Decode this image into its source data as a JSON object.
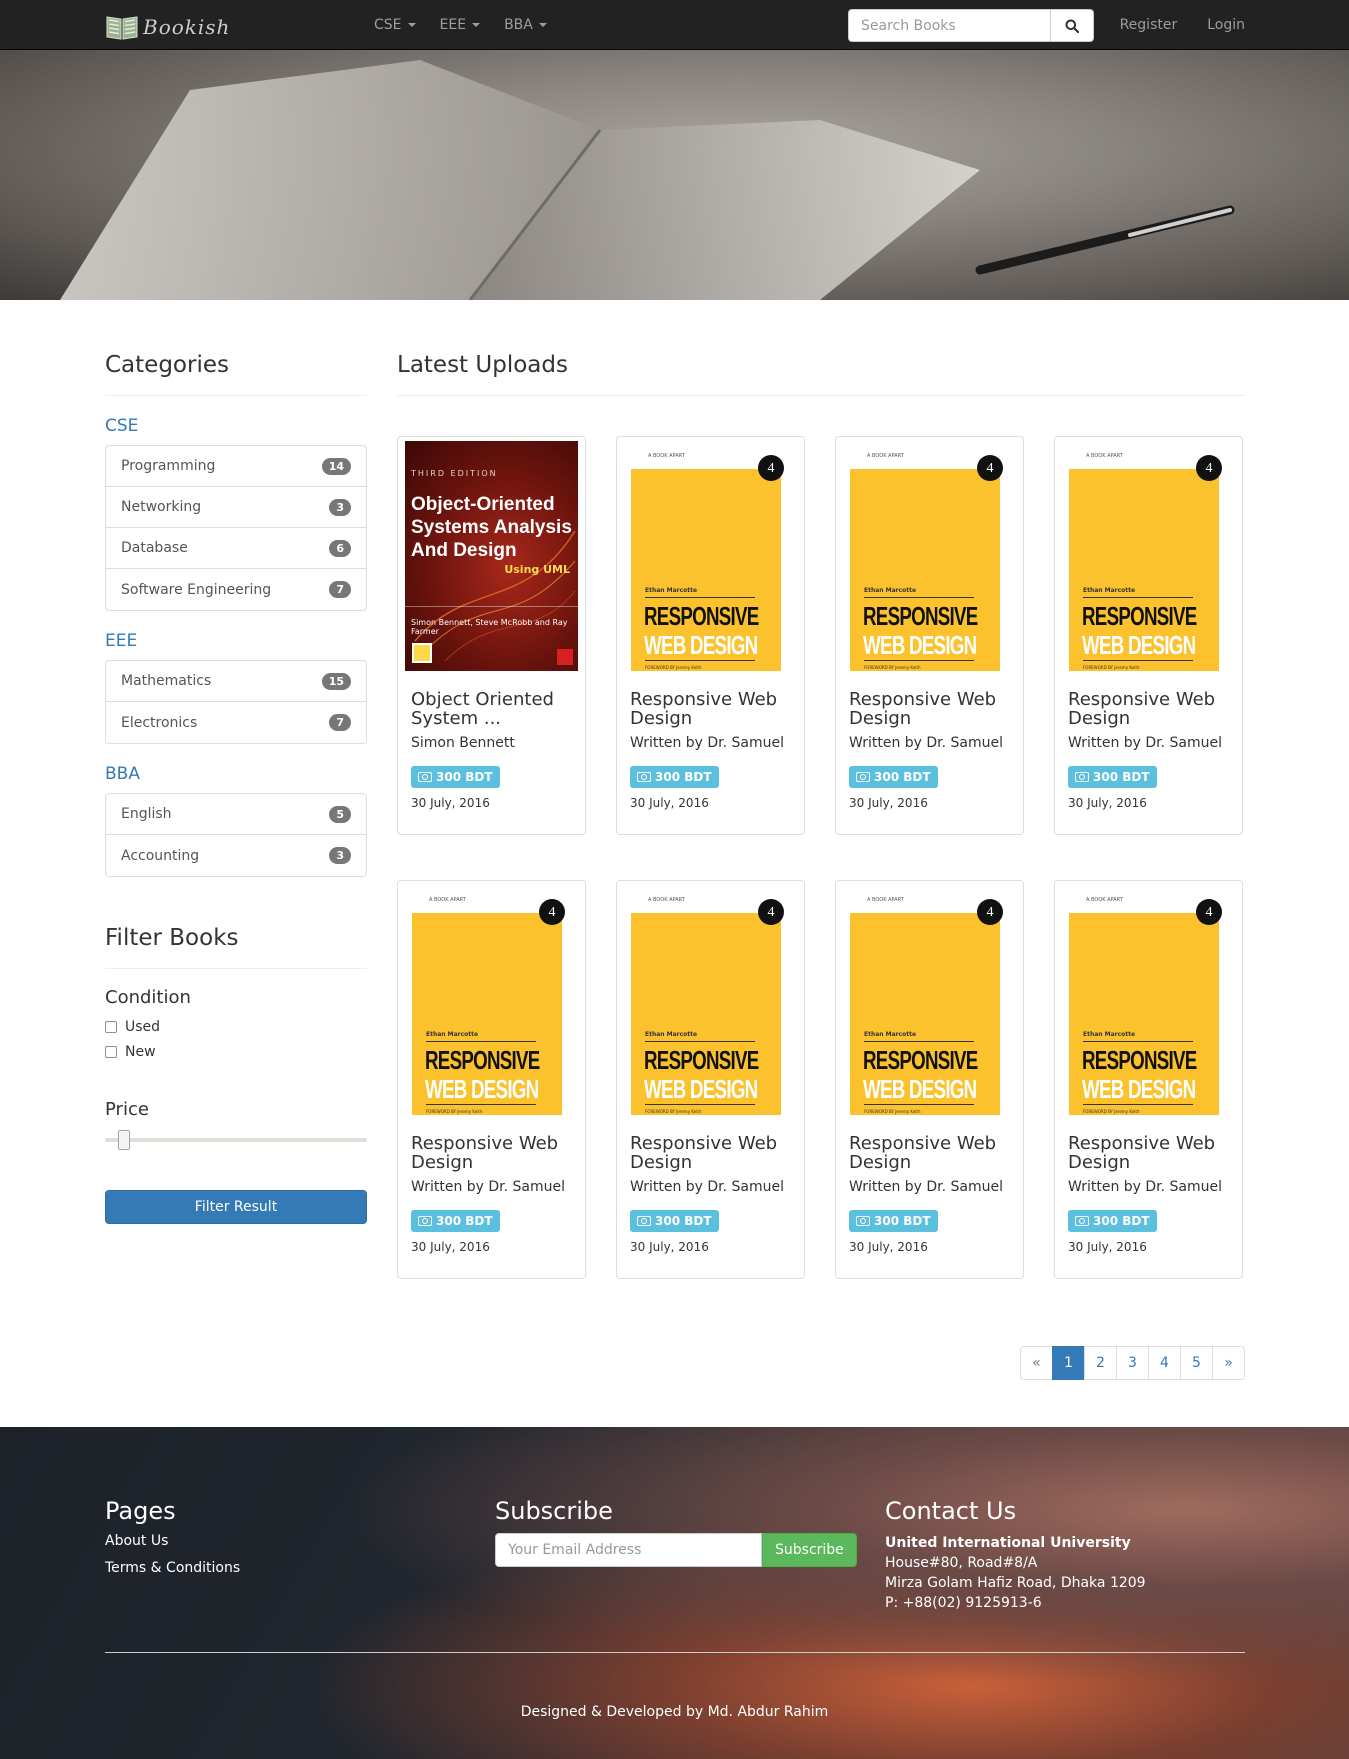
{
  "navbar": {
    "brand": "Bookish",
    "menu": [
      {
        "label": "CSE"
      },
      {
        "label": "EEE"
      },
      {
        "label": "BBA"
      }
    ],
    "search_placeholder": "Search Books",
    "register": "Register",
    "login": "Login"
  },
  "sidebar": {
    "categories_title": "Categories",
    "groups": [
      {
        "title": "CSE",
        "items": [
          {
            "label": "Programming",
            "count": "14"
          },
          {
            "label": "Networking",
            "count": "3"
          },
          {
            "label": "Database",
            "count": "6"
          },
          {
            "label": "Software Engineering",
            "count": "7"
          }
        ]
      },
      {
        "title": "EEE",
        "items": [
          {
            "label": "Mathematics",
            "count": "15"
          },
          {
            "label": "Electronics",
            "count": "7"
          }
        ]
      },
      {
        "title": "BBA",
        "items": [
          {
            "label": "English",
            "count": "5"
          },
          {
            "label": "Accounting",
            "count": "3"
          }
        ]
      }
    ],
    "filter_title": "Filter Books",
    "condition_title": "Condition",
    "conditions": [
      "Used",
      "New"
    ],
    "price_title": "Price",
    "price_slider_value": 0,
    "filter_button": "Filter Result"
  },
  "main": {
    "title": "Latest Uploads",
    "books": [
      {
        "cover": "ooad",
        "title": "Object Oriented System ...",
        "author": "Simon Bennett",
        "price": "300 BDT",
        "date": "30 July, 2016"
      },
      {
        "cover": "rwd",
        "title": "Responsive Web Design",
        "author": "Written by Dr. Samuel",
        "price": "300 BDT",
        "date": "30 July, 2016"
      },
      {
        "cover": "rwd",
        "title": "Responsive Web Design",
        "author": "Written by Dr. Samuel",
        "price": "300 BDT",
        "date": "30 July, 2016"
      },
      {
        "cover": "rwd",
        "title": "Responsive Web Design",
        "author": "Written by Dr. Samuel",
        "price": "300 BDT",
        "date": "30 July, 2016"
      },
      {
        "cover": "rwd",
        "title": "Responsive Web Design",
        "author": "Written by Dr. Samuel",
        "price": "300 BDT",
        "date": "30 July, 2016"
      },
      {
        "cover": "rwd",
        "title": "Responsive Web Design",
        "author": "Written by Dr. Samuel",
        "price": "300 BDT",
        "date": "30 July, 2016"
      },
      {
        "cover": "rwd",
        "title": "Responsive Web Design",
        "author": "Written by Dr. Samuel",
        "price": "300 BDT",
        "date": "30 July, 2016"
      },
      {
        "cover": "rwd",
        "title": "Responsive Web Design",
        "author": "Written by Dr. Samuel",
        "price": "300 BDT",
        "date": "30 July, 2016"
      }
    ],
    "covers": {
      "ooad": {
        "edition": "THIRD EDITION",
        "title_lines": [
          "Object-Oriented",
          "Systems Analysis",
          "And Design"
        ],
        "subtitle": "Using UML",
        "authors": "Simon Bennett, Steve McRobb and Ray Farmer"
      },
      "rwd": {
        "series": "A BOOK APART",
        "number": "4",
        "author": "Ethan Marcotte",
        "title_line1": "RESPONSIVE",
        "title_line2": "WEB DESIGN",
        "foreword": "FOREWORD BY Jeremy Keith"
      }
    }
  },
  "pagination": {
    "prev": "«",
    "pages": [
      "1",
      "2",
      "3",
      "4",
      "5"
    ],
    "active": "1",
    "next": "»"
  },
  "footer": {
    "pages_title": "Pages",
    "links": [
      "About Us",
      "Terms & Conditions"
    ],
    "subscribe_title": "Subscribe",
    "email_placeholder": "Your Email Address",
    "subscribe_button": "Subscribe",
    "contact_title": "Contact Us",
    "contact_name": "United International University",
    "contact_lines": [
      "House#80, Road#8/A",
      "Mirza Golam Hafiz Road, Dhaka 1209",
      "P: +88(02) 9125913-6"
    ],
    "credit": "Designed & Developed by Md. Abdur Rahim"
  },
  "colors": {
    "navbar": "#222222",
    "link": "#337ab7",
    "price_badge": "#5bc0de",
    "subscribe_button": "#5cb85c"
  }
}
